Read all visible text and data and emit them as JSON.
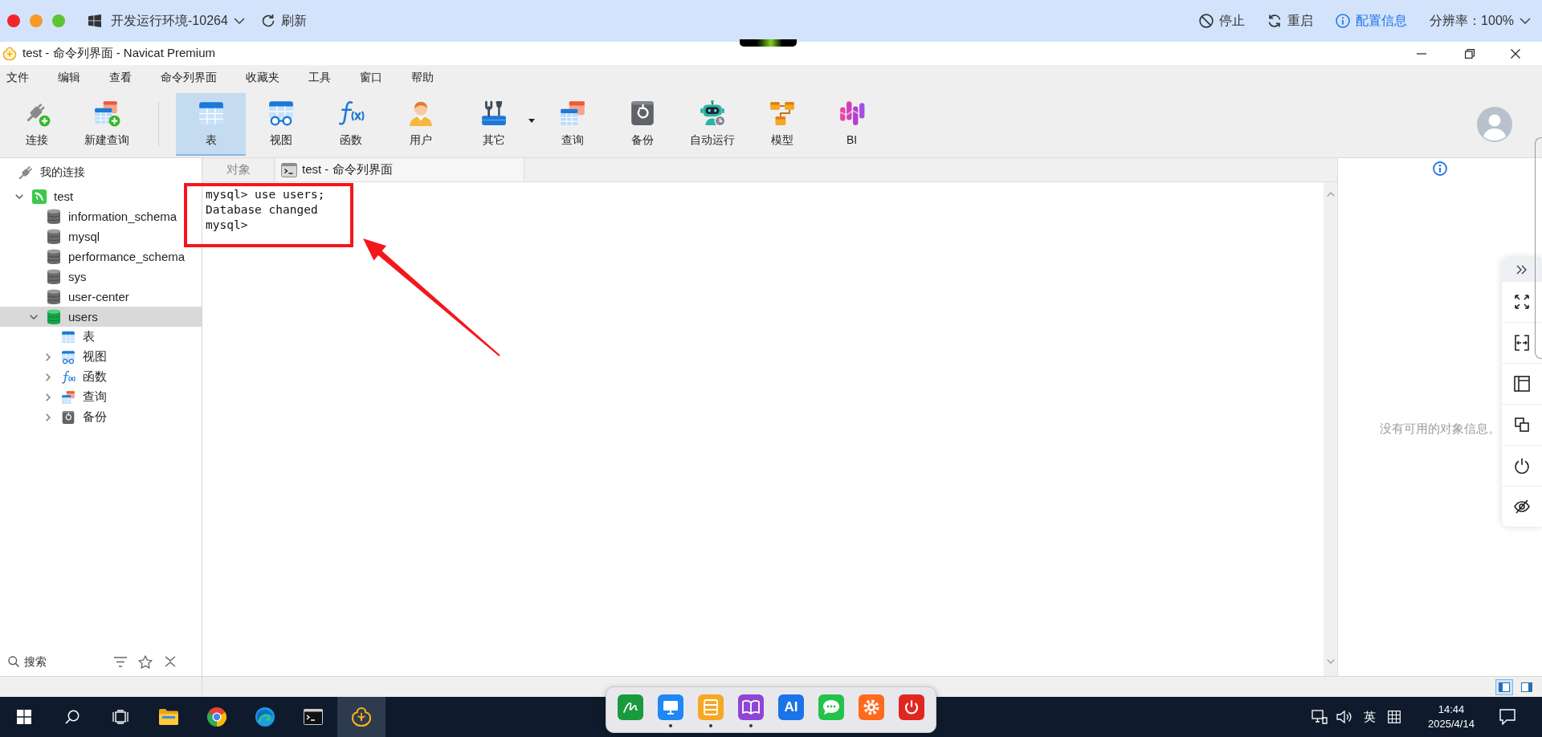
{
  "remote_bar": {
    "env": "开发运行环境-10264",
    "refresh": "刷新",
    "actions": [
      {
        "kind": "stop",
        "label": "停止"
      },
      {
        "kind": "restart",
        "label": "重启"
      },
      {
        "kind": "info",
        "label": "配置信息"
      }
    ],
    "resolution": "分辨率：100%"
  },
  "window": {
    "title": "test - 命令列界面 - Navicat Premium"
  },
  "menu": [
    "文件",
    "编辑",
    "查看",
    "命令列界面",
    "收藏夹",
    "工具",
    "窗口",
    "帮助"
  ],
  "toolbar": {
    "groups": [
      [
        {
          "kind": "connect",
          "label": "连接",
          "selected": false,
          "dropdown": false
        },
        {
          "kind": "newquery",
          "label": "新建查询",
          "selected": false,
          "dropdown": false
        }
      ],
      [
        {
          "kind": "table",
          "label": "表",
          "selected": true,
          "dropdown": false
        },
        {
          "kind": "view",
          "label": "视图",
          "selected": false,
          "dropdown": false
        },
        {
          "kind": "function",
          "label": "函数",
          "selected": false,
          "dropdown": false
        },
        {
          "kind": "user",
          "label": "用户",
          "selected": false,
          "dropdown": false
        },
        {
          "kind": "other",
          "label": "其它",
          "selected": false,
          "dropdown": true
        },
        {
          "kind": "query",
          "label": "查询",
          "selected": false,
          "dropdown": false
        },
        {
          "kind": "backup",
          "label": "备份",
          "selected": false,
          "dropdown": false
        },
        {
          "kind": "autorun",
          "label": "自动运行",
          "selected": false,
          "dropdown": false
        },
        {
          "kind": "model",
          "label": "模型",
          "selected": false,
          "dropdown": false
        },
        {
          "kind": "bi",
          "label": "BI",
          "selected": false,
          "dropdown": false
        }
      ]
    ]
  },
  "sidebar": {
    "header": "我的连接",
    "tree": [
      {
        "kind": "connection",
        "label": "test",
        "expanded": true,
        "selected": false,
        "children": [
          {
            "kind": "database",
            "label": "information_schema",
            "opened": false,
            "selected": false
          },
          {
            "kind": "database",
            "label": "mysql",
            "opened": false,
            "selected": false
          },
          {
            "kind": "database",
            "label": "performance_schema",
            "opened": false,
            "selected": false
          },
          {
            "kind": "database",
            "label": "sys",
            "opened": false,
            "selected": false
          },
          {
            "kind": "database",
            "label": "user-center",
            "opened": false,
            "selected": false
          },
          {
            "kind": "database",
            "label": "users",
            "opened": true,
            "expanded": true,
            "selected": true,
            "children": [
              {
                "kind": "tables",
                "label": "表",
                "selected": false
              },
              {
                "kind": "views",
                "label": "视图",
                "expanded": false,
                "selected": false
              },
              {
                "kind": "functions",
                "label": "函数",
                "expanded": false,
                "selected": false
              },
              {
                "kind": "queries",
                "label": "查询",
                "expanded": false,
                "selected": false
              },
              {
                "kind": "backups",
                "label": "备份",
                "expanded": false,
                "selected": false
              }
            ]
          }
        ]
      }
    ],
    "search": {
      "placeholder": "搜索"
    }
  },
  "tabs": [
    {
      "kind": "objects",
      "label": "对象",
      "selected": false
    },
    {
      "kind": "console",
      "label": "test - 命令列界面",
      "selected": true
    }
  ],
  "console": {
    "lines": [
      "mysql> use users;",
      "Database changed",
      "mysql>"
    ],
    "highlighted": true
  },
  "info_panel": {
    "message": "没有可用的对象信息。"
  },
  "side_tools": [
    {
      "kind": "collapse"
    },
    {
      "kind": "fullscreen"
    },
    {
      "kind": "split"
    },
    {
      "kind": "layout"
    },
    {
      "kind": "overlap"
    },
    {
      "kind": "power"
    },
    {
      "kind": "hide"
    }
  ],
  "status_bar": {
    "views": [
      {
        "kind": "left",
        "selected": true
      },
      {
        "kind": "right",
        "selected": false
      }
    ]
  },
  "taskbar": {
    "apps": [
      {
        "kind": "start",
        "active": false
      },
      {
        "kind": "search",
        "active": false
      },
      {
        "kind": "taskview",
        "active": false
      },
      {
        "kind": "explorer",
        "active": false
      },
      {
        "kind": "chrome",
        "active": false
      },
      {
        "kind": "edge",
        "active": false
      },
      {
        "kind": "terminal",
        "active": false
      },
      {
        "kind": "navicat",
        "active": true
      }
    ],
    "dock": [
      {
        "kind": "sign",
        "running": false
      },
      {
        "kind": "monitor",
        "running": true
      },
      {
        "kind": "list",
        "running": true
      },
      {
        "kind": "book",
        "running": true
      },
      {
        "kind": "ai",
        "label": "AI",
        "running": false
      },
      {
        "kind": "chat",
        "running": false
      },
      {
        "kind": "gear",
        "running": false
      },
      {
        "kind": "power",
        "running": false
      }
    ],
    "tray": {
      "ime": "英",
      "time": "14:44",
      "date": "2025/4/14"
    }
  }
}
